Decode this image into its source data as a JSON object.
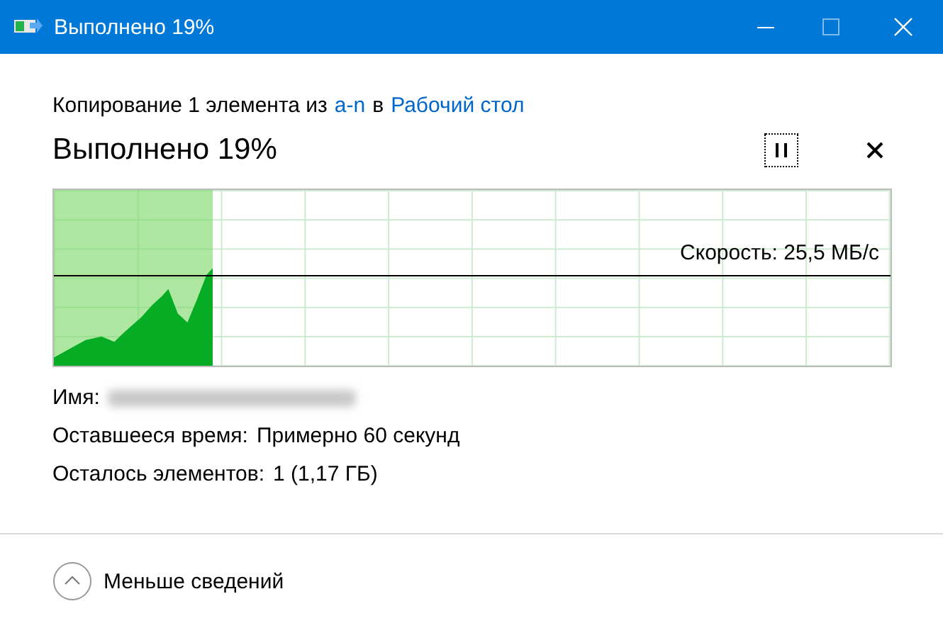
{
  "window": {
    "title": "Выполнено 19%"
  },
  "subtitle": [
    {
      "kind": "text",
      "text": "Копирование 1 элемента из"
    },
    {
      "kind": "link",
      "text": "a-n"
    },
    {
      "kind": "text",
      "text": "в"
    },
    {
      "kind": "link",
      "text": "Рабочий стол"
    }
  ],
  "heading": "Выполнено 19%",
  "progress": {
    "level": 0.19,
    "speed": "Скорость: 25,5 МБ/с"
  },
  "details": [
    {
      "label": "Имя:",
      "redacted": true
    },
    {
      "label": "Оставшееся время:",
      "value": "Примерно 60 секунд"
    },
    {
      "label": "Осталось элементов:",
      "value": "1 (1,17 ГБ)"
    }
  ],
  "footer": {
    "toggle": "Меньше сведений",
    "expanded": true
  }
}
